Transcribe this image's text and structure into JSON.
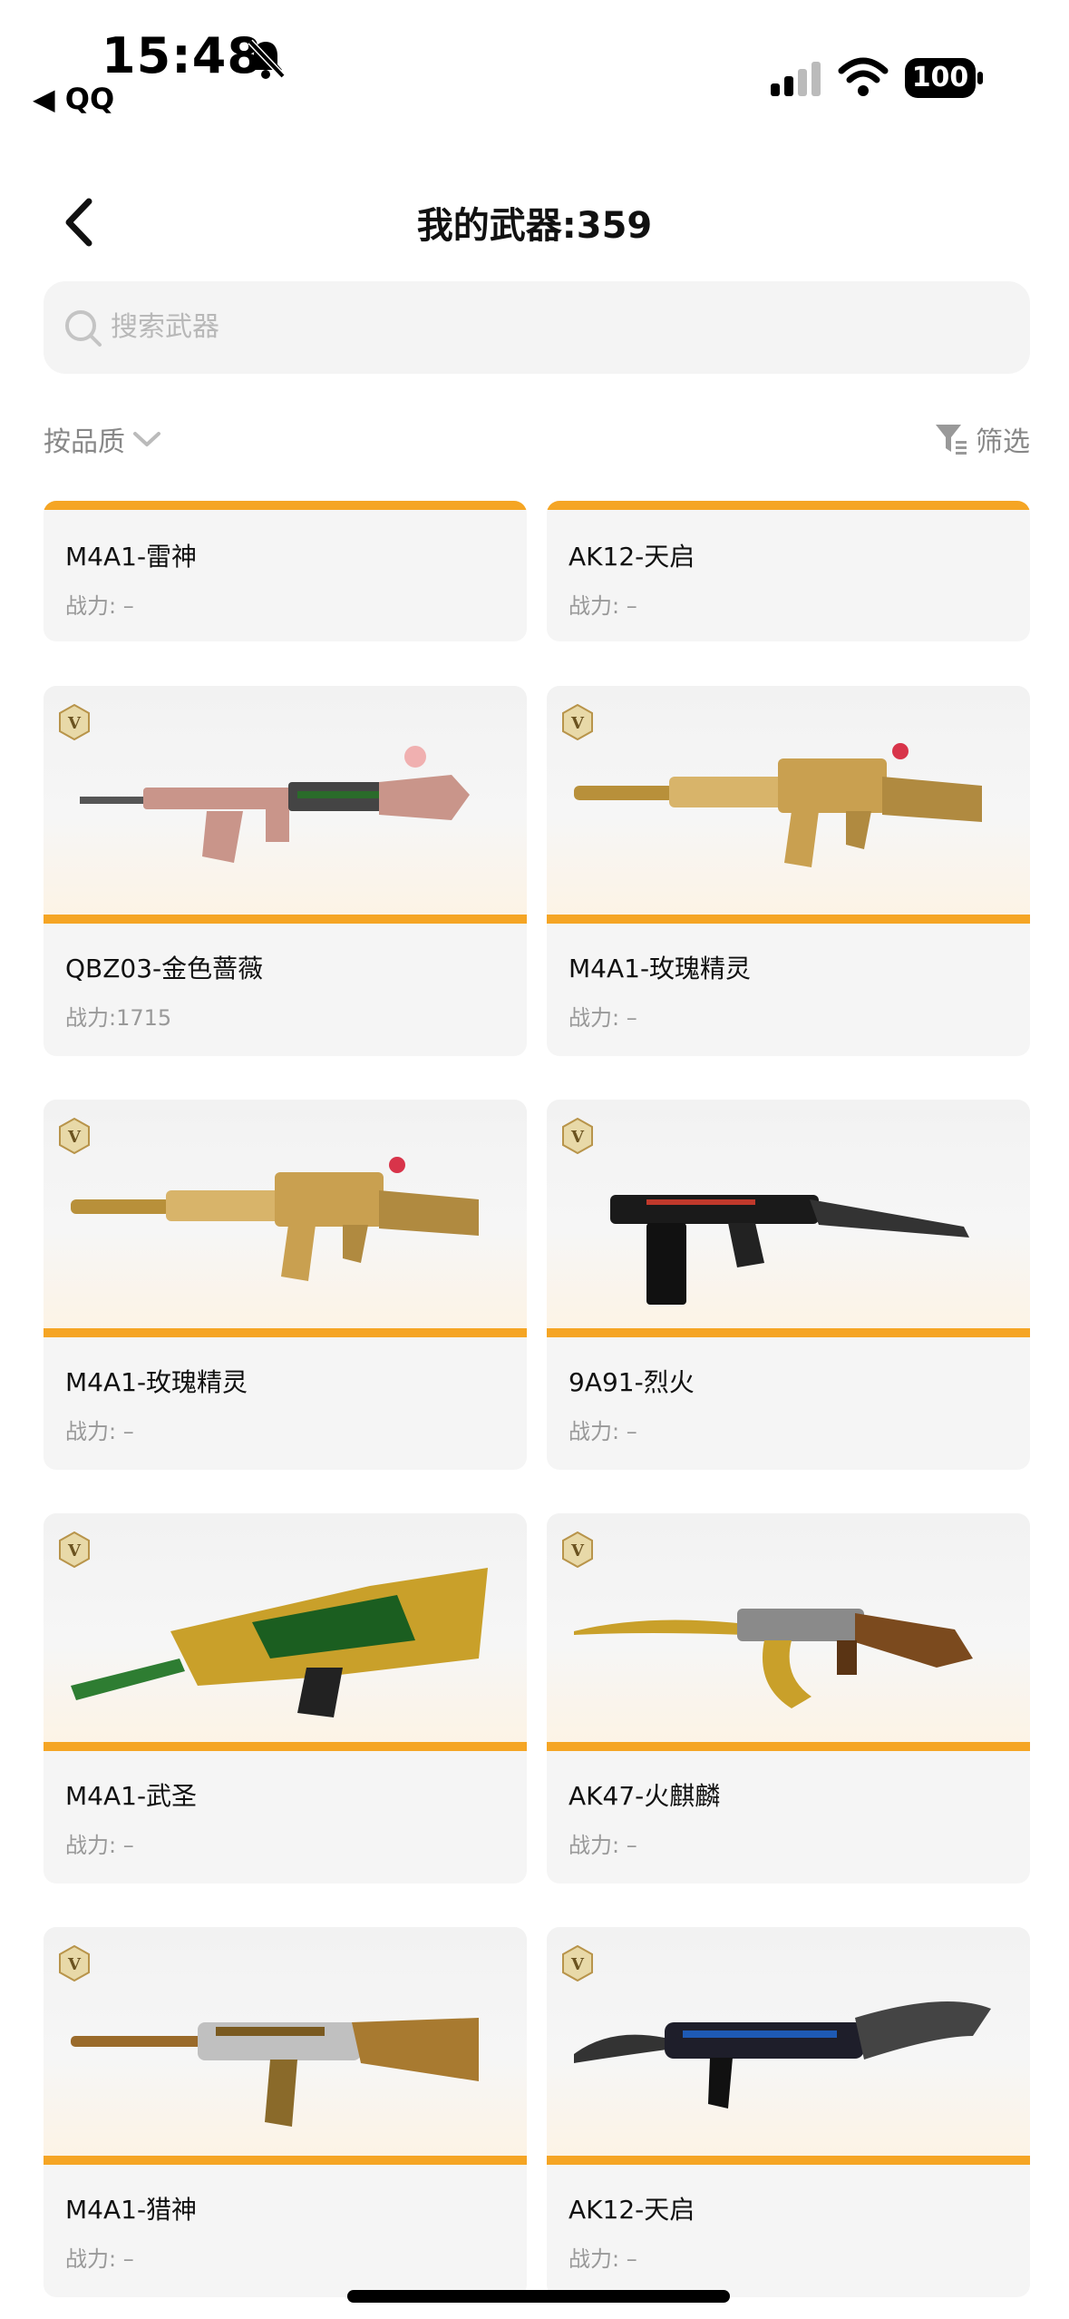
{
  "status_bar": {
    "time": "15:48",
    "back_app": "◀ QQ",
    "battery": "100"
  },
  "header": {
    "title": "我的武器:359"
  },
  "search": {
    "placeholder": "搜索武器"
  },
  "toolbar": {
    "sort_label": "按品质",
    "filter_label": "筛选"
  },
  "colors": {
    "accent": "#f5a524",
    "card_bg": "#f5f5f5",
    "muted_text": "#999999"
  },
  "weapons_partial": [
    {
      "name": "M4A1-雷神",
      "power": "战力: –"
    },
    {
      "name": "AK12-天启",
      "power": "战力: –"
    }
  ],
  "weapons": [
    {
      "name": "QBZ03-金色蔷薇",
      "power": "战力:1715",
      "icon": "rifle-pink"
    },
    {
      "name": "M4A1-玫瑰精灵",
      "power": "战力: –",
      "icon": "rifle-gold"
    },
    {
      "name": "M4A1-玫瑰精灵",
      "power": "战力: –",
      "icon": "rifle-gold"
    },
    {
      "name": "9A91-烈火",
      "power": "战力: –",
      "icon": "rifle-black"
    },
    {
      "name": "M4A1-武圣",
      "power": "战力: –",
      "icon": "rifle-dragon"
    },
    {
      "name": "AK47-火麒麟",
      "power": "战力: –",
      "icon": "rifle-ak"
    },
    {
      "name": "M4A1-猎神",
      "power": "战力: –",
      "icon": "rifle-hunter"
    },
    {
      "name": "AK12-天启",
      "power": "战力: –",
      "icon": "rifle-blue"
    }
  ]
}
